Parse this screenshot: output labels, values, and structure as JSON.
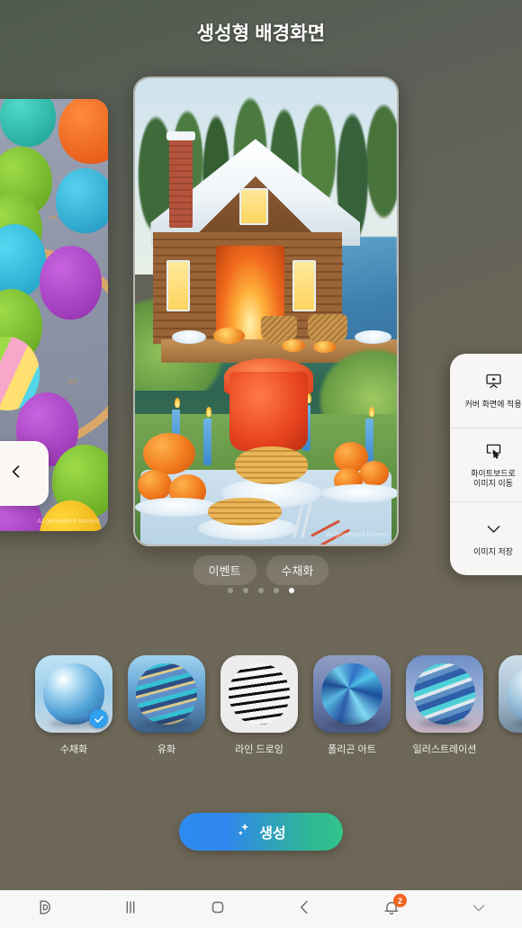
{
  "header": {
    "title": "생성형 배경화면"
  },
  "carousel": {
    "prev_button_icon": "chevron-left-icon",
    "main_image": {
      "alt": "watercolor cabin by the lake with thanksgiving feast",
      "watermark": "AI-generated content"
    },
    "prev_image": {
      "alt": "polygon art easter eggs in a basket",
      "watermark": "AI-generated content"
    },
    "tags": [
      {
        "label": "이벤트"
      },
      {
        "label": "수채화"
      }
    ],
    "pagination": {
      "count": 5,
      "active_index": 4
    }
  },
  "action_sheet": {
    "items": [
      {
        "icon": "cover-screen-icon",
        "label": "커버 화면에 적용"
      },
      {
        "icon": "whiteboard-icon",
        "label": "화이트보드로\n이미지 이동"
      },
      {
        "icon": "download-chevron-icon",
        "label": "이미지 저장"
      }
    ],
    "item_0_label": "커버 화면에 적용",
    "item_1_label_line1": "화이트보드로",
    "item_1_label_line2": "이미지 이동",
    "item_2_label": "이미지 저장"
  },
  "styles": {
    "selected_index": 0,
    "items": [
      {
        "name": "수채화",
        "selected": true
      },
      {
        "name": "유화",
        "selected": false
      },
      {
        "name": "라인 드로잉",
        "selected": false
      },
      {
        "name": "폴리곤 아트",
        "selected": false
      },
      {
        "name": "일러스트레이션",
        "selected": false
      },
      {
        "name": "",
        "selected": false
      }
    ]
  },
  "generate_button": {
    "label": "생성",
    "icon": "sparkle-icon"
  },
  "navbar": {
    "items": [
      {
        "icon": "bixby-icon",
        "label": ""
      },
      {
        "icon": "recents-icon",
        "label": ""
      },
      {
        "icon": "home-icon",
        "label": ""
      },
      {
        "icon": "back-icon",
        "label": ""
      },
      {
        "icon": "notification-bell-icon",
        "badge": "2"
      },
      {
        "icon": "chevron-down-icon",
        "label": ""
      }
    ],
    "notification_badge": "2"
  },
  "colors": {
    "background_top": "#4f5a4c",
    "background_bottom": "#6b6557",
    "accent_blue": "#2f9ff0",
    "badge_orange": "#f0641e",
    "generate_gradient_start": "#2d8bf0",
    "generate_gradient_end": "#32c48b"
  }
}
